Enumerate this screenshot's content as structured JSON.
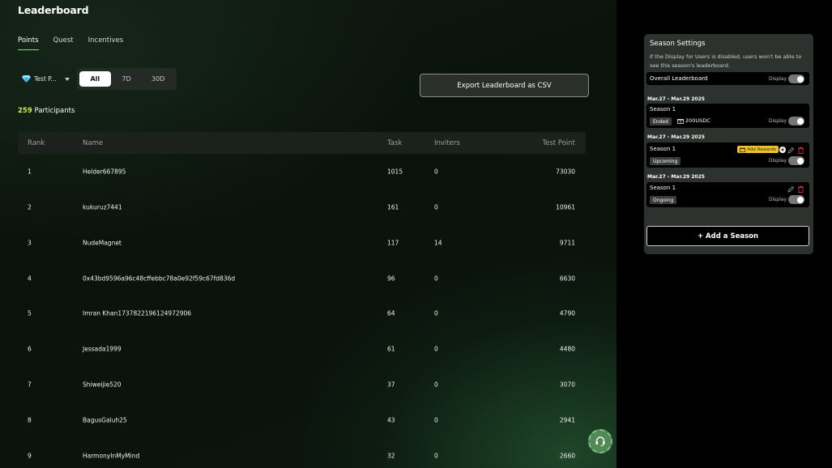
{
  "header": {
    "title": "Leaderboard"
  },
  "tabs": [
    {
      "label": "Points",
      "active": true
    },
    {
      "label": "Quest",
      "active": false
    },
    {
      "label": "Incentives",
      "active": false
    }
  ],
  "token_selector": {
    "label": "Test P...",
    "icon": "diamond-icon"
  },
  "range_filter": {
    "options": [
      "All",
      "7D",
      "30D"
    ],
    "selected": "All"
  },
  "export_button": {
    "label": "Export Leaderboard as CSV"
  },
  "participants": {
    "count": "259",
    "label": " Participants"
  },
  "table": {
    "columns": {
      "rank": "Rank",
      "name": "Name",
      "task": "Task",
      "inviters": "Inviters",
      "points": "Test Point"
    },
    "rows": [
      {
        "rank": "1",
        "name": "Helder667895",
        "task": "1015",
        "inviters": "0",
        "points": "73030"
      },
      {
        "rank": "2",
        "name": "kukuruz7441",
        "task": "161",
        "inviters": "0",
        "points": "10961"
      },
      {
        "rank": "3",
        "name": "NudeMagnet",
        "task": "117",
        "inviters": "14",
        "points": "9711"
      },
      {
        "rank": "4",
        "name": "0x43bd9596a96c48cffebbc78a0e92f59c67fd836d",
        "task": "96",
        "inviters": "0",
        "points": "6630"
      },
      {
        "rank": "5",
        "name": "Imran Khan1737822196124972906",
        "task": "64",
        "inviters": "0",
        "points": "4790"
      },
      {
        "rank": "6",
        "name": "Jessada1999",
        "task": "61",
        "inviters": "0",
        "points": "4480"
      },
      {
        "rank": "7",
        "name": "Shiweijie520",
        "task": "37",
        "inviters": "0",
        "points": "3070"
      },
      {
        "rank": "8",
        "name": "BagusGaluh25",
        "task": "43",
        "inviters": "0",
        "points": "2941"
      },
      {
        "rank": "9",
        "name": "HarmonyInMyMind",
        "task": "32",
        "inviters": "0",
        "points": "2660"
      }
    ]
  },
  "season_settings": {
    "title": "Season Settings",
    "description": "If the Display for Users is disabled, users won't be able to see this season's leaderboard.",
    "overall": {
      "label": "Overall Leaderboard",
      "display_label": "Display",
      "display_on": true
    },
    "seasons": [
      {
        "date": "Mar.27 - Mar.29 2025",
        "name": "Season 1",
        "status": "Ended",
        "reward": "200USDC",
        "display_label": "Display",
        "display_on": true
      },
      {
        "date": "Mar.27 - Mar.29 2025",
        "name": "Season 1",
        "status": "Upcoming",
        "add_rewards": "Add Rewards",
        "display_label": "Display",
        "display_on": true
      },
      {
        "date": "Mar.27 - Mar.29 2025",
        "name": "Season 1",
        "status": "Ongoing",
        "display_label": "Display",
        "display_on": true
      }
    ],
    "add_button": "+ Add a Season"
  },
  "colors": {
    "accent_green": "#7be36a",
    "count_green": "#c8e86a",
    "reward_yellow": "#e9c22f",
    "delete_red": "#d23b3b"
  }
}
